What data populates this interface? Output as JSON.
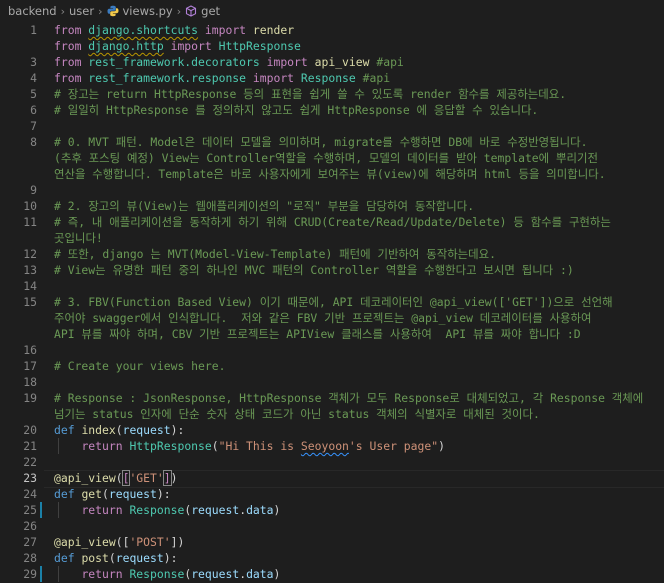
{
  "breadcrumb": {
    "items": [
      "backend",
      "user",
      "views.py",
      "get"
    ]
  },
  "colors": {
    "background": "#1e1e1e",
    "comment": "#6a9955",
    "keyword": "#c586c0",
    "string": "#ce9178",
    "function": "#dcdcaa",
    "class": "#4ec9b0",
    "modified_gutter": "#1b81a8"
  },
  "editor": {
    "current_line": 23,
    "lines": [
      {
        "n": "1",
        "tokens": [
          [
            "kw",
            "from"
          ],
          [
            "t",
            " "
          ],
          [
            "mod",
            "django.shortcuts",
            1
          ],
          [
            "t",
            " "
          ],
          [
            "kw",
            "import"
          ],
          [
            "t",
            " "
          ],
          [
            "fn",
            "render"
          ]
        ]
      },
      {
        "n": "",
        "tokens": [
          [
            "kw",
            "from"
          ],
          [
            "t",
            " "
          ],
          [
            "mod",
            "django.http",
            1
          ],
          [
            "t",
            " "
          ],
          [
            "kw",
            "import"
          ],
          [
            "t",
            " "
          ],
          [
            "cls",
            "HttpResponse"
          ]
        ]
      },
      {
        "n": "3",
        "tokens": [
          [
            "kw",
            "from"
          ],
          [
            "t",
            " "
          ],
          [
            "mod",
            "rest_framework.decorators"
          ],
          [
            "t",
            " "
          ],
          [
            "kw",
            "import"
          ],
          [
            "t",
            " "
          ],
          [
            "fn",
            "api_view"
          ],
          [
            "t",
            " "
          ],
          [
            "cm",
            "#api"
          ]
        ]
      },
      {
        "n": "4",
        "tokens": [
          [
            "kw",
            "from"
          ],
          [
            "t",
            " "
          ],
          [
            "mod",
            "rest_framework.response"
          ],
          [
            "t",
            " "
          ],
          [
            "kw",
            "import"
          ],
          [
            "t",
            " "
          ],
          [
            "cls",
            "Response"
          ],
          [
            "t",
            " "
          ],
          [
            "cm",
            "#api"
          ]
        ]
      },
      {
        "n": "5",
        "tokens": [
          [
            "cm",
            "# 장고는 return HttpResponse 등의 표현을 쉽게 쓸 수 있도록 render 함수를 제공하는데요."
          ]
        ]
      },
      {
        "n": "6",
        "tokens": [
          [
            "cm",
            "# 일일히 HttpResponse 를 정의하지 않고도 쉽게 HttpResponse 에 응답할 수 있습니다."
          ]
        ]
      },
      {
        "n": "7",
        "tokens": []
      },
      {
        "n": "8",
        "tokens": [
          [
            "cm",
            "# 0. MVT 패턴. Model은 데이터 모델을 의미하며, migrate를 수행하면 DB에 바로 수정반영됩니다."
          ]
        ]
      },
      {
        "n": "",
        "tokens": [
          [
            "cm",
            "(추후 포스팅 예정) View는 Controller역할을 수행하며, 모델의 데이터를 받아 template에 뿌리기전"
          ]
        ]
      },
      {
        "n": "",
        "tokens": [
          [
            "cm",
            "연산을 수행합니다. Template은 바로 사용자에게 보여주는 뷰(view)에 해당하며 html 등을 의미합니다."
          ]
        ]
      },
      {
        "n": "9",
        "tokens": []
      },
      {
        "n": "10",
        "tokens": [
          [
            "cm",
            "# 2. 장고의 뷰(View)는 웹애플리케이션의 \"로직\" 부분을 담당하여 동작합니다."
          ]
        ]
      },
      {
        "n": "11",
        "tokens": [
          [
            "cm",
            "# 즉, 내 애플리케이션을 동작하게 하기 위해 CRUD(Create/Read/Update/Delete) 등 함수를 구현하는"
          ]
        ]
      },
      {
        "n": "",
        "tokens": [
          [
            "cm",
            "곳입니다!"
          ]
        ]
      },
      {
        "n": "12",
        "tokens": [
          [
            "cm",
            "# 또한, django 는 MVT(Model-View-Template) 패턴에 기반하여 동작하는데요."
          ]
        ]
      },
      {
        "n": "13",
        "tokens": [
          [
            "cm",
            "# View는 유명한 패턴 중의 하나인 MVC 패턴의 Controller 역할을 수행한다고 보시면 됩니다 :)"
          ]
        ]
      },
      {
        "n": "14",
        "tokens": []
      },
      {
        "n": "15",
        "tokens": [
          [
            "cm",
            "# 3. FBV(Function Based View) 이기 때문에, API 데코레이터인 @api_view(['GET'])으로 선언해"
          ]
        ]
      },
      {
        "n": "",
        "tokens": [
          [
            "cm",
            "주어야 swagger에서 인식합니다.  저와 같은 FBV 기반 프로젝트는 @api_view 데코레이터를 사용하여"
          ]
        ]
      },
      {
        "n": "",
        "tokens": [
          [
            "cm",
            "API 뷰를 짜야 하며, CBV 기반 프로젝트는 APIView 클래스를 사용하여  API 뷰를 짜야 합니다 :D"
          ]
        ]
      },
      {
        "n": "16",
        "tokens": []
      },
      {
        "n": "17",
        "tokens": [
          [
            "cm",
            "# Create your views here."
          ]
        ]
      },
      {
        "n": "18",
        "tokens": []
      },
      {
        "n": "19",
        "tokens": [
          [
            "cm",
            "# Response : JsonResponse, HttpResponse 객체가 모두 Response로 대체되었고, 각 Response 객체에"
          ]
        ]
      },
      {
        "n": "",
        "tokens": [
          [
            "cm",
            "넘기는 status 인자에 단순 숫자 상태 코드가 아닌 status 객체의 식별자로 대체된 것이다."
          ]
        ]
      },
      {
        "n": "20",
        "tokens": [
          [
            "kw2",
            "def"
          ],
          [
            "t",
            " "
          ],
          [
            "fn",
            "index"
          ],
          [
            "t",
            "("
          ],
          [
            "var",
            "request"
          ],
          [
            "t",
            "):"
          ]
        ]
      },
      {
        "n": "21",
        "indent": 1,
        "tokens": [
          [
            "t",
            "    "
          ],
          [
            "kw",
            "return"
          ],
          [
            "t",
            " "
          ],
          [
            "cls",
            "HttpResponse"
          ],
          [
            "t",
            "("
          ],
          [
            "str",
            "\"Hi This is "
          ],
          [
            "str",
            "Seoyoon",
            2
          ],
          [
            "str",
            "'s User page\""
          ],
          [
            "t",
            ")"
          ]
        ]
      },
      {
        "n": "22",
        "tokens": []
      },
      {
        "n": "23",
        "current": 1,
        "tokens": [
          [
            "fn",
            "@api_view"
          ],
          [
            "t",
            "("
          ],
          [
            "box",
            "['GET']"
          ],
          [
            "t",
            ")"
          ]
        ]
      },
      {
        "n": "24",
        "tokens": [
          [
            "kw2",
            "def"
          ],
          [
            "t",
            " "
          ],
          [
            "fn",
            "get"
          ],
          [
            "t",
            "("
          ],
          [
            "var",
            "request"
          ],
          [
            "t",
            "):"
          ]
        ]
      },
      {
        "n": "25",
        "indent": 1,
        "modified": 1,
        "tokens": [
          [
            "t",
            "    "
          ],
          [
            "kw",
            "return"
          ],
          [
            "t",
            " "
          ],
          [
            "cls",
            "Response"
          ],
          [
            "t",
            "("
          ],
          [
            "var",
            "request"
          ],
          [
            "t",
            "."
          ],
          [
            "var",
            "data"
          ],
          [
            "t",
            ")"
          ]
        ]
      },
      {
        "n": "26",
        "tokens": []
      },
      {
        "n": "27",
        "tokens": [
          [
            "fn",
            "@api_view"
          ],
          [
            "t",
            "(["
          ],
          [
            "str",
            "'POST'"
          ],
          [
            "t",
            "])"
          ]
        ]
      },
      {
        "n": "28",
        "tokens": [
          [
            "kw2",
            "def"
          ],
          [
            "t",
            " "
          ],
          [
            "fn",
            "post"
          ],
          [
            "t",
            "("
          ],
          [
            "var",
            "request"
          ],
          [
            "t",
            "):"
          ]
        ]
      },
      {
        "n": "29",
        "indent": 1,
        "modified": 1,
        "tokens": [
          [
            "t",
            "    "
          ],
          [
            "kw",
            "return"
          ],
          [
            "t",
            " "
          ],
          [
            "cls",
            "Response"
          ],
          [
            "t",
            "("
          ],
          [
            "var",
            "request"
          ],
          [
            "t",
            "."
          ],
          [
            "var",
            "data"
          ],
          [
            "t",
            ")"
          ]
        ]
      }
    ]
  }
}
